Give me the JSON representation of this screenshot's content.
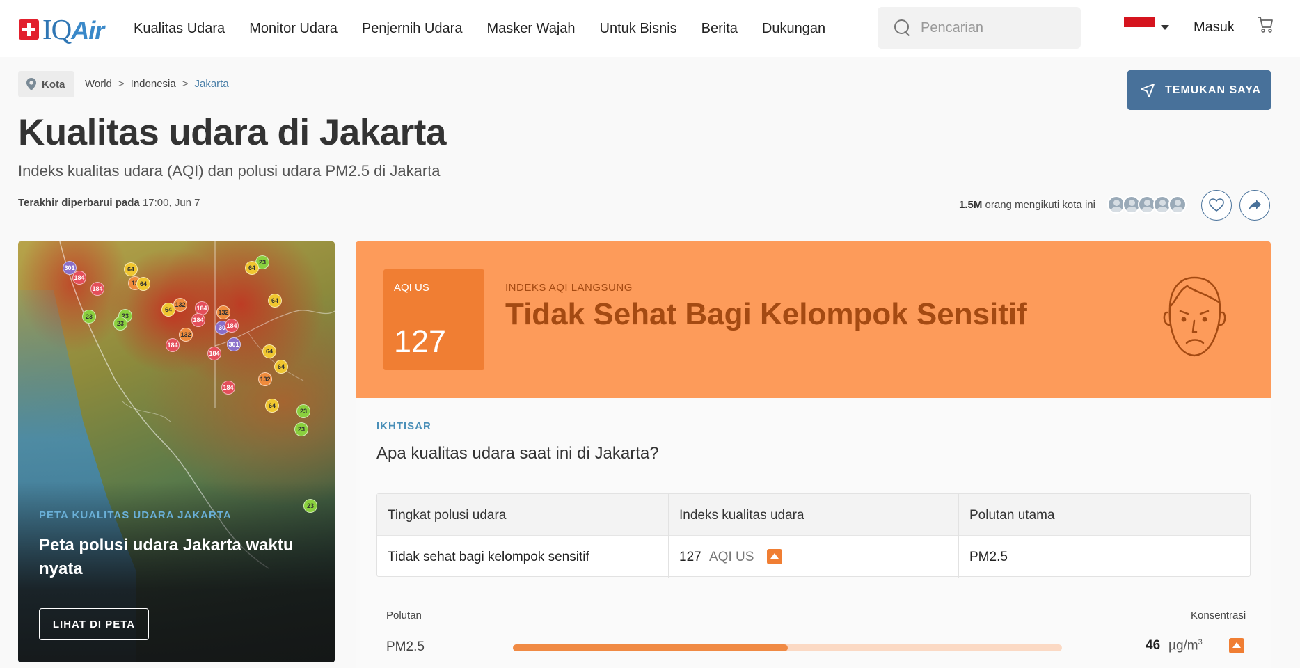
{
  "nav": {
    "logo_iq": "IQ",
    "logo_air": "Air",
    "menu": [
      "Kualitas Udara",
      "Monitor Udara",
      "Penjernih Udara",
      "Masker Wajah",
      "Untuk Bisnis",
      "Berita",
      "Dukungan"
    ],
    "search_placeholder": "Pencarian",
    "login": "Masuk",
    "colors": {
      "flag_red": "#d5141e",
      "logo_blue": "#2f76b4"
    }
  },
  "breadcrumb": {
    "pill_label": "Kota",
    "items": [
      "World",
      "Indonesia",
      "Jakarta"
    ],
    "separator": ">"
  },
  "find_button": "TEMUKAN SAYA",
  "header": {
    "title": "Kualitas udara di Jakarta",
    "subtitle": "Indeks kualitas udara (AQI) dan polusi udara PM2.5 di Jakarta",
    "updated_label": "Terakhir diperbarui pada",
    "updated_value": "17:00, Jun 7"
  },
  "followers": {
    "count": "1.5M",
    "text": "orang mengikuti kota ini"
  },
  "map_card": {
    "tag": "PETA KUALITAS UDARA JAKARTA",
    "heading": "Peta polusi udara Jakarta waktu nyata",
    "button": "LIHAT DI PETA",
    "markers": [
      {
        "v": "301",
        "c": "p"
      },
      {
        "v": "184",
        "c": "r"
      },
      {
        "v": "184",
        "c": "r"
      },
      {
        "v": "64",
        "c": "y"
      },
      {
        "v": "13",
        "c": "o"
      },
      {
        "v": "64",
        "c": "y"
      },
      {
        "v": "64",
        "c": "y"
      },
      {
        "v": "23",
        "c": "g"
      },
      {
        "v": "23",
        "c": "g"
      },
      {
        "v": "23",
        "c": "g"
      },
      {
        "v": "23",
        "c": "g"
      },
      {
        "v": "64",
        "c": "y"
      },
      {
        "v": "132",
        "c": "o"
      },
      {
        "v": "184",
        "c": "r"
      },
      {
        "v": "132",
        "c": "o"
      },
      {
        "v": "64",
        "c": "y"
      },
      {
        "v": "184",
        "c": "r"
      },
      {
        "v": "30",
        "c": "p"
      },
      {
        "v": "184",
        "c": "r"
      },
      {
        "v": "132",
        "c": "o"
      },
      {
        "v": "184",
        "c": "r"
      },
      {
        "v": "301",
        "c": "p"
      },
      {
        "v": "184",
        "c": "r"
      },
      {
        "v": "64",
        "c": "y"
      },
      {
        "v": "64",
        "c": "y"
      },
      {
        "v": "132",
        "c": "o"
      },
      {
        "v": "184",
        "c": "r"
      },
      {
        "v": "64",
        "c": "y"
      },
      {
        "v": "23",
        "c": "g"
      },
      {
        "v": "23",
        "c": "g"
      },
      {
        "v": "23",
        "c": "g"
      }
    ]
  },
  "aqi": {
    "label": "AQI US",
    "value": "127",
    "live_label": "INDEKS AQI LANGSUNG",
    "status": "Tidak Sehat Bagi Kelompok Sensitif",
    "colors": {
      "panel": "#fd9b5a",
      "box": "#f07e33",
      "text": "#a44a12"
    }
  },
  "overview": {
    "tag": "IKHTISAR",
    "question": "Apa kualitas udara saat ini di Jakarta?",
    "table": {
      "headers": [
        "Tingkat polusi udara",
        "Indeks kualitas udara",
        "Polutan utama"
      ],
      "level": "Tidak sehat bagi kelompok sensitif",
      "aqi_value": "127",
      "aqi_unit": "AQI US",
      "main_pollutant": "PM2.5"
    },
    "pollutants": {
      "header_left": "Polutan",
      "header_right": "Konsentrasi",
      "rows": [
        {
          "name": "PM2.5",
          "value": "46",
          "unit": "µg/m",
          "unit_exp": "3",
          "bar_fraction": 0.5
        }
      ]
    }
  }
}
